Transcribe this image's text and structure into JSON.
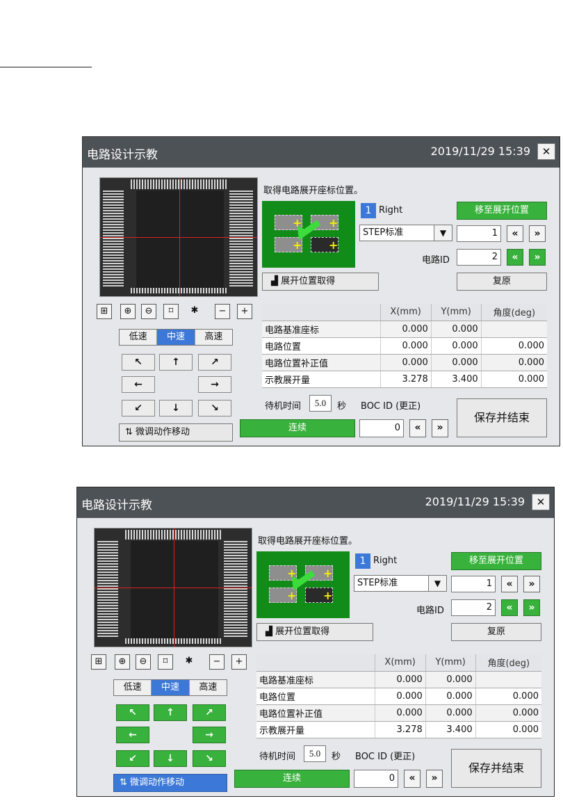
{
  "dialogs": [
    {
      "title": "电路设计示教",
      "datetime": "2019/11/29 15:39",
      "close_glyph": "✕",
      "instruction": "取得电路展开座标位置。",
      "index_badge": "1",
      "side_label": "Right",
      "step_select": "STEP标准",
      "move_button": "移至展开位置",
      "step_value": "1",
      "circuit_id_label": "电路ID",
      "circuit_id_value": "2",
      "acquire_button": "展开位置取得",
      "restore_button": "复原",
      "speed": {
        "low": "低速",
        "mid": "中速",
        "high": "高速",
        "selected": "中速"
      },
      "table": {
        "headers": [
          "",
          "X(mm)",
          "Y(mm)",
          "角度(deg)"
        ],
        "rows": [
          [
            "电路基准座标",
            "0.000",
            "0.000",
            ""
          ],
          [
            "电路位置",
            "0.000",
            "0.000",
            "0.000"
          ],
          [
            "电路位置补正值",
            "0.000",
            "0.000",
            "0.000"
          ],
          [
            "示教展开量",
            "3.278",
            "3.400",
            "0.000"
          ]
        ]
      },
      "wait_label": "待机时间",
      "wait_value": "5.0",
      "wait_unit": "秒",
      "boc_label": "BOC ID (更正)",
      "boc_value": "0",
      "fine_move_button": "微调动作移动",
      "continuous_button": "连续",
      "save_button": "保存并结束",
      "arrows_green": false,
      "fine_move_active": false
    },
    {
      "title": "电路设计示教",
      "datetime": "2019/11/29 15:39",
      "close_glyph": "✕",
      "instruction": "取得电路展开座标位置。",
      "index_badge": "1",
      "side_label": "Right",
      "step_select": "STEP标准",
      "move_button": "移至展开位置",
      "step_value": "1",
      "circuit_id_label": "电路ID",
      "circuit_id_value": "2",
      "acquire_button": "展开位置取得",
      "restore_button": "复原",
      "speed": {
        "low": "低速",
        "mid": "中速",
        "high": "高速",
        "selected": "中速"
      },
      "table": {
        "headers": [
          "",
          "X(mm)",
          "Y(mm)",
          "角度(deg)"
        ],
        "rows": [
          [
            "电路基准座标",
            "0.000",
            "0.000",
            ""
          ],
          [
            "电路位置",
            "0.000",
            "0.000",
            "0.000"
          ],
          [
            "电路位置补正值",
            "0.000",
            "0.000",
            "0.000"
          ],
          [
            "示教展开量",
            "3.278",
            "3.400",
            "0.000"
          ]
        ]
      },
      "wait_label": "待机时间",
      "wait_value": "5.0",
      "wait_unit": "秒",
      "boc_label": "BOC ID (更正)",
      "boc_value": "0",
      "fine_move_button": "微调动作移动",
      "continuous_button": "连续",
      "save_button": "保存并结束",
      "arrows_green": true,
      "fine_move_active": true
    }
  ],
  "colors": {
    "titlebar": "#4d5257",
    "accent_blue": "#3c78d8",
    "accent_green": "#38b23c",
    "schematic_green": "#118c19"
  }
}
